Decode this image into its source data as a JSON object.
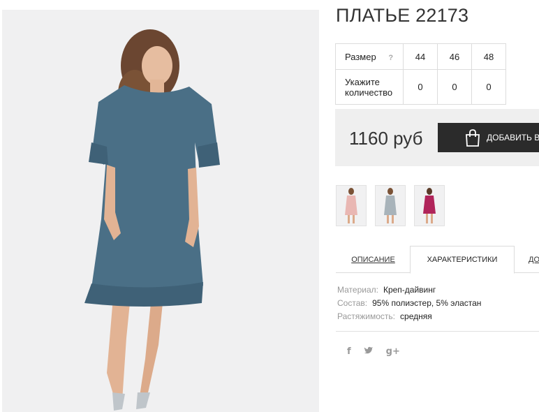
{
  "product": {
    "title": "ПЛАТЬЕ 22173"
  },
  "size_table": {
    "size_label": "Размер",
    "help_icon": "?",
    "sizes": [
      "44",
      "46",
      "48"
    ],
    "quantity_label": "Укажите количество",
    "quantities": [
      "0",
      "0",
      "0"
    ]
  },
  "buy": {
    "price": "1160 руб",
    "add_label": "ДОБАВИТЬ В",
    "icon": "shopping-bag-icon"
  },
  "thumbnails": [
    {
      "name": "pink-dress-thumbnail",
      "color": "#e9b7b3"
    },
    {
      "name": "grey-dress-thumbnail",
      "color": "#a8b3ba"
    },
    {
      "name": "magenta-dress-thumbnail",
      "color": "#b0245a"
    }
  ],
  "tabs": [
    {
      "label": "ОПИСАНИЕ",
      "active": false
    },
    {
      "label": "ХАРАКТЕРИСТИКИ",
      "active": true
    },
    {
      "label": "ДО",
      "active": false
    }
  ],
  "specs": [
    {
      "key": "Материал:",
      "value": "Креп-дайвинг"
    },
    {
      "key": "Состав:",
      "value": "95% полиэстер, 5% эластан"
    },
    {
      "key": "Растяжимость:",
      "value": "средняя"
    }
  ],
  "social": [
    {
      "icon": "facebook-icon",
      "glyph": "f"
    },
    {
      "icon": "twitter-icon",
      "glyph": "t"
    },
    {
      "icon": "google-plus-icon",
      "glyph": "g+"
    }
  ],
  "colors": {
    "dress": "#4a6f86",
    "button": "#2b2b2b",
    "price_bar": "#efefef"
  }
}
